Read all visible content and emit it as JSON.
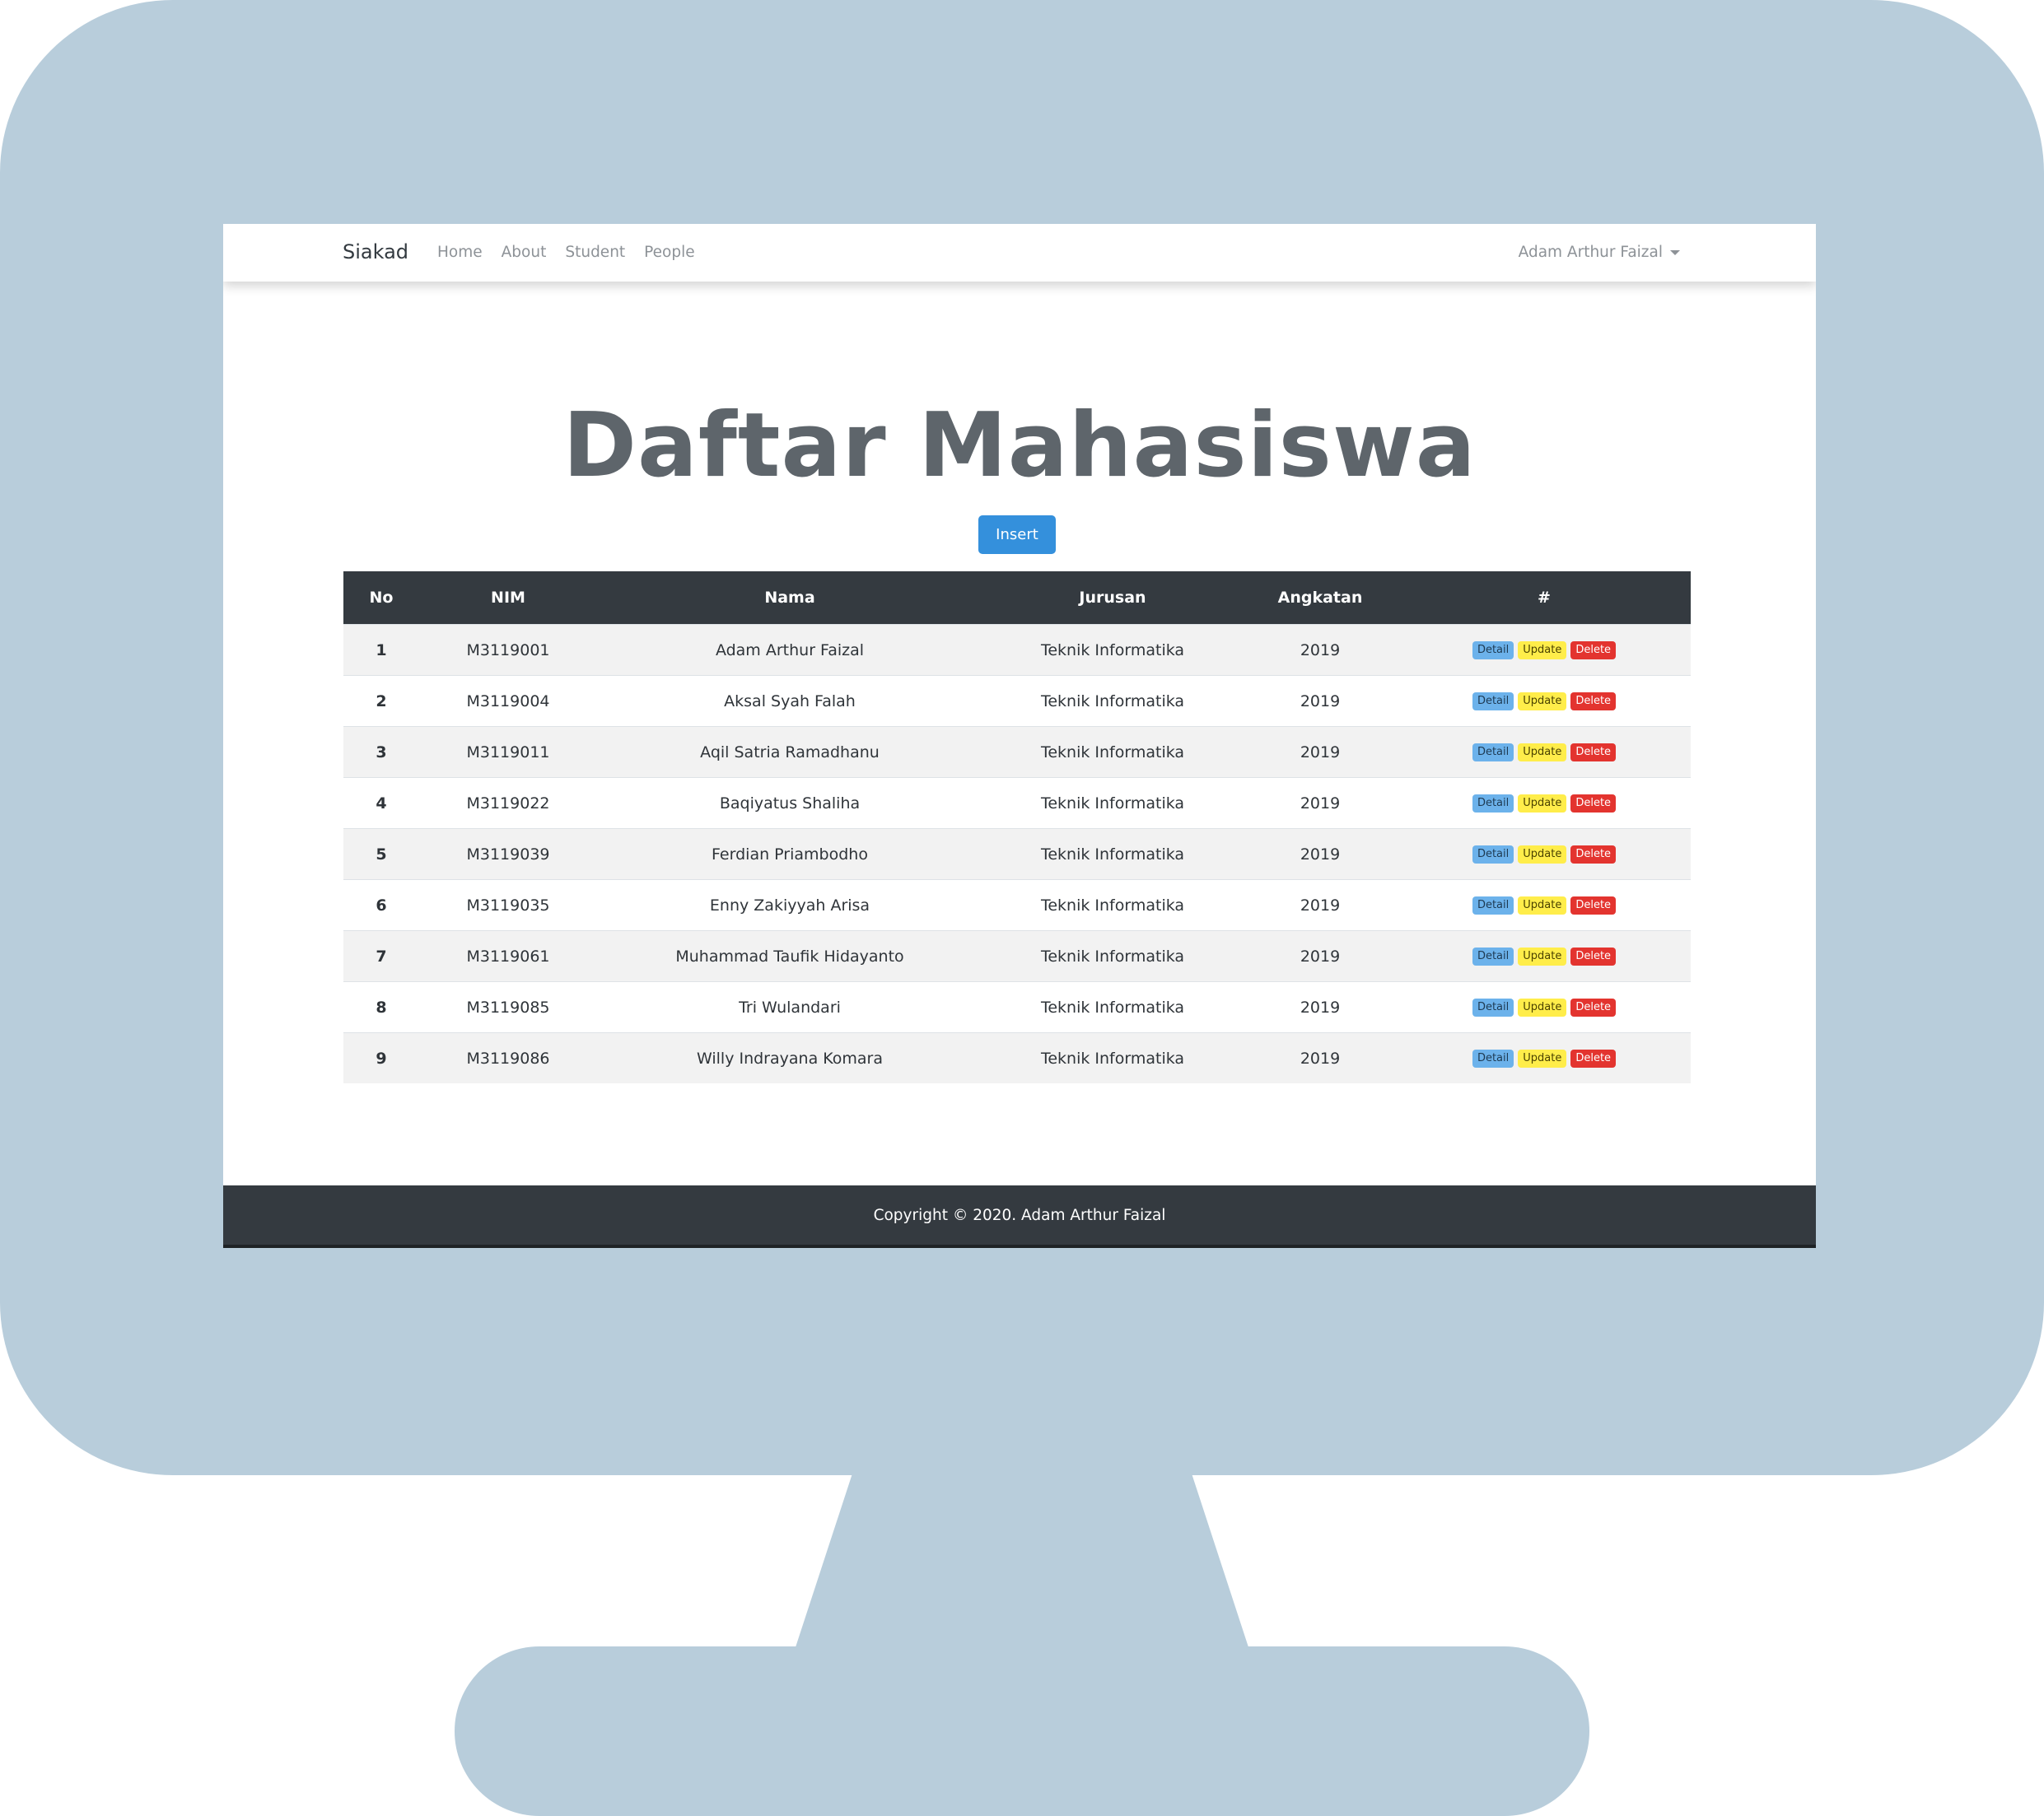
{
  "navbar": {
    "brand": "Siakad",
    "links": [
      "Home",
      "About",
      "Student",
      "People"
    ],
    "user": "Adam Arthur Faizal"
  },
  "main": {
    "title": "Daftar Mahasiswa",
    "insert_label": "Insert"
  },
  "table": {
    "headers": [
      "No",
      "NIM",
      "Nama",
      "Jurusan",
      "Angkatan",
      "#"
    ],
    "action_labels": {
      "detail": "Detail",
      "update": "Update",
      "delete": "Delete"
    },
    "rows": [
      {
        "no": "1",
        "nim": "M3119001",
        "nama": "Adam Arthur Faizal",
        "jurusan": "Teknik Informatika",
        "angkatan": "2019"
      },
      {
        "no": "2",
        "nim": "M3119004",
        "nama": "Aksal Syah Falah",
        "jurusan": "Teknik Informatika",
        "angkatan": "2019"
      },
      {
        "no": "3",
        "nim": "M3119011",
        "nama": "Aqil Satria Ramadhanu",
        "jurusan": "Teknik Informatika",
        "angkatan": "2019"
      },
      {
        "no": "4",
        "nim": "M3119022",
        "nama": "Baqiyatus Shaliha",
        "jurusan": "Teknik Informatika",
        "angkatan": "2019"
      },
      {
        "no": "5",
        "nim": "M3119039",
        "nama": "Ferdian Priambodho",
        "jurusan": "Teknik Informatika",
        "angkatan": "2019"
      },
      {
        "no": "6",
        "nim": "M3119035",
        "nama": "Enny Zakiyyah Arisa",
        "jurusan": "Teknik Informatika",
        "angkatan": "2019"
      },
      {
        "no": "7",
        "nim": "M3119061",
        "nama": "Muhammad Taufik Hidayanto",
        "jurusan": "Teknik Informatika",
        "angkatan": "2019"
      },
      {
        "no": "8",
        "nim": "M3119085",
        "nama": "Tri Wulandari",
        "jurusan": "Teknik Informatika",
        "angkatan": "2019"
      },
      {
        "no": "9",
        "nim": "M3119086",
        "nama": "Willy Indrayana Komara",
        "jurusan": "Teknik Informatika",
        "angkatan": "2019"
      }
    ]
  },
  "footer": {
    "copyright": "Copyright © 2020. Adam Arthur Faizal"
  },
  "colors": {
    "monitor": "#b8cddb",
    "dark": "#343a40",
    "primary": "#3490dc",
    "info": "#6cb2eb",
    "warning": "#ffed4a",
    "danger": "#e3342f"
  },
  "icons": {
    "user_menu": "caret-down-icon"
  }
}
